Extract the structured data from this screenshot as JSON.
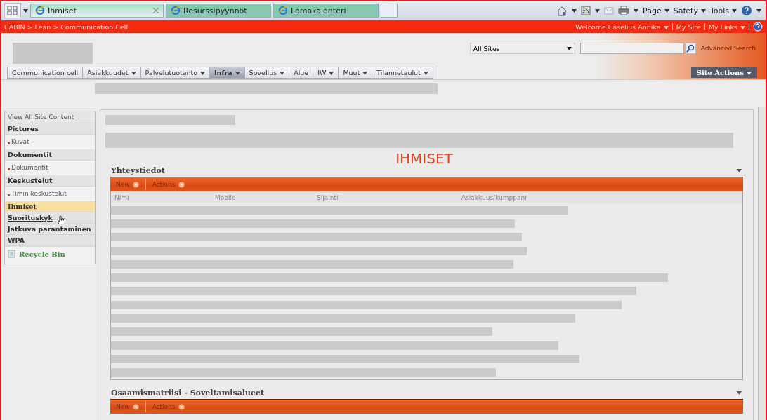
{
  "browser_tabs": [
    {
      "label": "Ihmiset",
      "selected": true
    },
    {
      "label": "Resurssipyynnöt",
      "selected": false
    },
    {
      "label": "Lomakalenteri",
      "selected": false
    }
  ],
  "browser_commands": [
    "Page",
    "Safety",
    "Tools"
  ],
  "breadcrumb": "CABIN > Lean > Communication Cell",
  "user_links": [
    {
      "label": "Welcome Caselius Annika",
      "dropdown": true
    },
    {
      "label": "My Site",
      "dropdown": false
    },
    {
      "label": "My Links",
      "dropdown": true
    }
  ],
  "search": {
    "scope": "All Sites",
    "advanced": "Advanced Search"
  },
  "nav": [
    {
      "label": "Communication cell",
      "dropdown": false,
      "selected": false
    },
    {
      "label": "Asiakkuudet",
      "dropdown": true,
      "selected": false
    },
    {
      "label": "Palvelutuotanto",
      "dropdown": true,
      "selected": false
    },
    {
      "label": "Infra",
      "dropdown": true,
      "selected": true
    },
    {
      "label": "Sovellus",
      "dropdown": true,
      "selected": false
    },
    {
      "label": "Alue",
      "dropdown": false,
      "selected": false
    },
    {
      "label": "IW",
      "dropdown": true,
      "selected": false
    },
    {
      "label": "Muut",
      "dropdown": true,
      "selected": false
    },
    {
      "label": "Tilannetaulut",
      "dropdown": true,
      "selected": false
    }
  ],
  "site_actions": "Site Actions",
  "sidebar": [
    {
      "kind": "link",
      "label": "View All Site Content"
    },
    {
      "kind": "heading",
      "label": "Pictures",
      "selected": false
    },
    {
      "kind": "item",
      "label": "Kuvat"
    },
    {
      "kind": "heading",
      "label": "Dokumentit",
      "selected": false
    },
    {
      "kind": "item",
      "label": "Dokumentit"
    },
    {
      "kind": "heading",
      "label": "Keskustelut",
      "selected": false
    },
    {
      "kind": "item",
      "label": "Timin keskustelut"
    },
    {
      "kind": "heading",
      "label": "Ihmiset",
      "selected": true
    },
    {
      "kind": "heading",
      "label": "Suorituskyk",
      "selected": false,
      "hovered": true
    },
    {
      "kind": "heading",
      "label": "Jatkuva parantaminen",
      "selected": false
    },
    {
      "kind": "heading",
      "label": "WPA",
      "selected": false
    },
    {
      "kind": "recycle",
      "label": "Recycle Bin"
    }
  ],
  "page_title": "IHMISET",
  "webparts": [
    {
      "title": "Yhteystiedot",
      "toolbar": [
        "New",
        "Actions"
      ],
      "columns": [
        "Nimi",
        "Mobile",
        "Sijainti",
        "Asiakkuus/kumppani"
      ]
    },
    {
      "title": "Osaamismatriisi - Soveltamisalueet",
      "toolbar": [
        "New",
        "Actions"
      ]
    }
  ]
}
